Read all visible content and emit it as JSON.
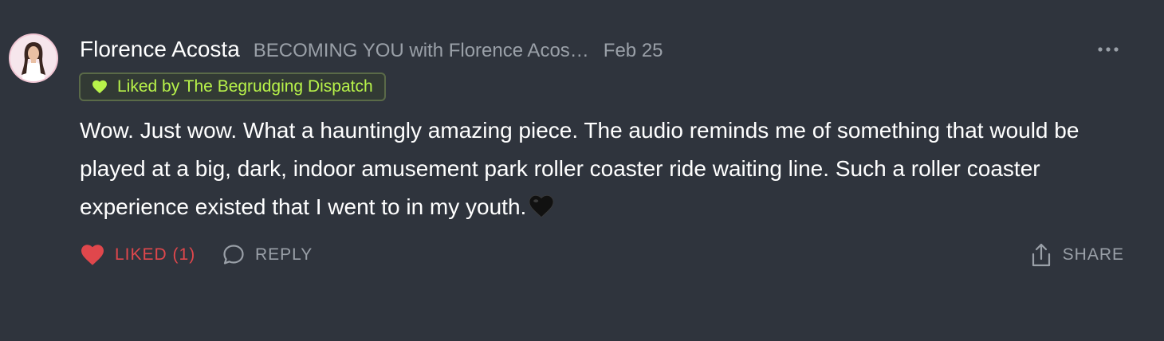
{
  "comment": {
    "author": "Florence Acosta",
    "publication": "BECOMING YOU with Florence Acos…",
    "date": "Feb 25",
    "liked_badge": "Liked by The Begrudging Dispatch",
    "body": "Wow. Just wow. What a hauntingly amazing piece. The audio reminds me of something that would be played at a big, dark, indoor amusement park roller coaster ride waiting line. Such a roller coaster experience existed that I went to in my youth.",
    "emoji": "black-heart-icon"
  },
  "actions": {
    "like_label": "LIKED (1)",
    "reply_label": "REPLY",
    "share_label": "SHARE"
  },
  "colors": {
    "background": "#2f343d",
    "liked_red": "#e0474c",
    "badge_green": "#b8f34a",
    "muted": "#9aa0a8"
  }
}
